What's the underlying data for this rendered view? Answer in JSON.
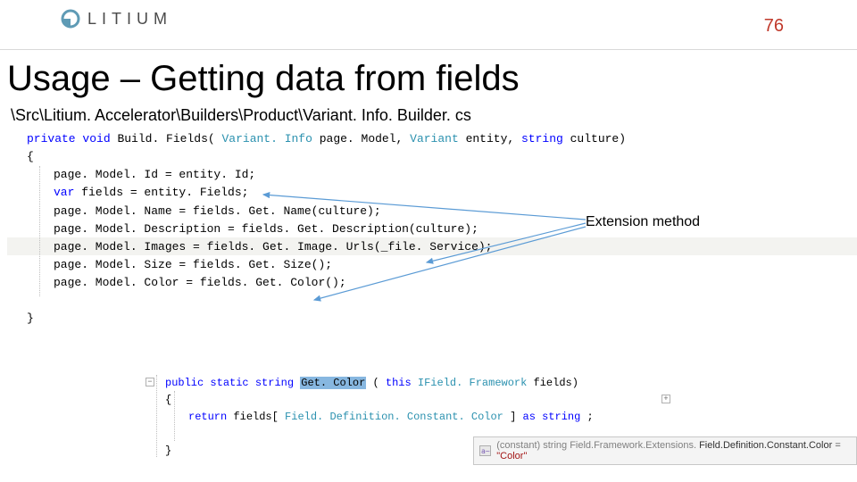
{
  "header": {
    "brand": "LITIUM",
    "page_number": "76"
  },
  "slide": {
    "title": "Usage – Getting data from fields",
    "file_path": "\\Src\\Litium. Accelerator\\Builders\\Product\\Variant. Info. Builder. cs"
  },
  "annotation": {
    "label": "Extension method"
  },
  "code1": {
    "sig_kw1": "private",
    "sig_kw2": "void",
    "sig_name": " Build. Fields(",
    "sig_t1": "Variant. Info",
    "sig_p1": " page. Model, ",
    "sig_t2": "Variant",
    "sig_p2": " entity, ",
    "sig_kw3": "string",
    "sig_p3": " culture)",
    "brace_open": "{",
    "l1": "page. Model. Id = entity. Id;",
    "l2_kw": "var",
    "l2_rest": " fields = entity. Fields;",
    "l3": "page. Model. Name = fields. Get. Name(culture);",
    "l4": "page. Model. Description = fields. Get. Description(culture);",
    "l5": "page. Model. Images = fields. Get. Image. Urls(_file. Service);",
    "l6": "page. Model. Size = fields. Get. Size();",
    "l7": "page. Model. Color = fields. Get. Color();",
    "brace_close": "}"
  },
  "code2": {
    "sig_kw1": "public",
    "sig_kw2": "static",
    "sig_kw3": "string",
    "sig_name_sel": "Get. Color",
    "sig_open": "(",
    "sig_kw4": "this",
    "sig_t1": "IField. Framework",
    "sig_p1": " fields)",
    "brace_open": "{",
    "ret_kw": "return",
    "ret_mid": " fields[",
    "ret_const": "Field. Definition. Constant. Color",
    "ret_tail": "] ",
    "ret_kw2": "as",
    "ret_kw3": "string",
    "ret_semi": ";",
    "brace_close": "}"
  },
  "tooltip": {
    "icon_text": "a̴",
    "label": "(constant) string ",
    "type": "Field.Framework.Extensions.",
    "member": "Field.Definition.Constant.Color",
    "eq": " = ",
    "value": "\"Color\""
  }
}
